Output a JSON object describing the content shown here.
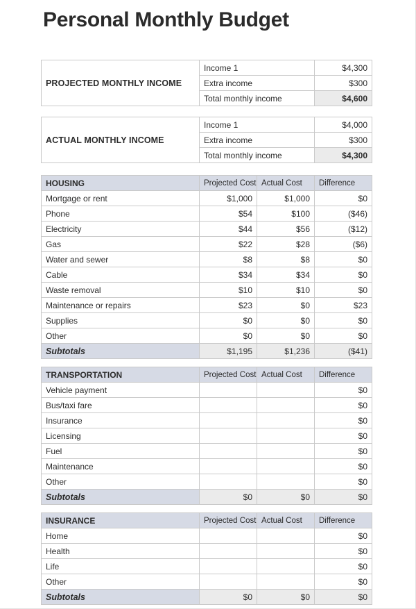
{
  "document": {
    "title": "Personal Monthly Budget"
  },
  "income_tables": [
    {
      "title": "PROJECTED MONTHLY INCOME",
      "rows": [
        {
          "label": "Income 1",
          "value": "$4,300",
          "total": false
        },
        {
          "label": "Extra income",
          "value": "$300",
          "total": false
        },
        {
          "label": "Total monthly income",
          "value": "$4,600",
          "total": true
        }
      ]
    },
    {
      "title": "ACTUAL MONTHLY INCOME",
      "rows": [
        {
          "label": "Income 1",
          "value": "$4,000",
          "total": false
        },
        {
          "label": "Extra income",
          "value": "$300",
          "total": false
        },
        {
          "label": "Total monthly income",
          "value": "$4,300",
          "total": true
        }
      ]
    }
  ],
  "columns": {
    "projected": "Projected Cost",
    "actual": "Actual Cost",
    "difference": "Difference"
  },
  "subtotal_label": "Subtotals",
  "sections": [
    {
      "name": "HOUSING",
      "rows": [
        {
          "label": "Mortgage or rent",
          "projected": "$1,000",
          "actual": "$1,000",
          "difference": "$0",
          "negative": false
        },
        {
          "label": "Phone",
          "projected": "$54",
          "actual": "$100",
          "difference": "($46)",
          "negative": true
        },
        {
          "label": "Electricity",
          "projected": "$44",
          "actual": "$56",
          "difference": "($12)",
          "negative": true
        },
        {
          "label": "Gas",
          "projected": "$22",
          "actual": "$28",
          "difference": "($6)",
          "negative": true
        },
        {
          "label": "Water and sewer",
          "projected": "$8",
          "actual": "$8",
          "difference": "$0",
          "negative": false
        },
        {
          "label": "Cable",
          "projected": "$34",
          "actual": "$34",
          "difference": "$0",
          "negative": false
        },
        {
          "label": "Waste removal",
          "projected": "$10",
          "actual": "$10",
          "difference": "$0",
          "negative": false
        },
        {
          "label": "Maintenance or repairs",
          "projected": "$23",
          "actual": "$0",
          "difference": "$23",
          "negative": false
        },
        {
          "label": "Supplies",
          "projected": "$0",
          "actual": "$0",
          "difference": "$0",
          "negative": false
        },
        {
          "label": "Other",
          "projected": "$0",
          "actual": "$0",
          "difference": "$0",
          "negative": false
        }
      ],
      "subtotals": {
        "projected": "$1,195",
        "actual": "$1,236",
        "difference": "($41)",
        "negative": true
      }
    },
    {
      "name": "TRANSPORTATION",
      "rows": [
        {
          "label": "Vehicle payment",
          "projected": "",
          "actual": "",
          "difference": "$0",
          "negative": false
        },
        {
          "label": "Bus/taxi fare",
          "projected": "",
          "actual": "",
          "difference": "$0",
          "negative": false
        },
        {
          "label": "Insurance",
          "projected": "",
          "actual": "",
          "difference": "$0",
          "negative": false
        },
        {
          "label": "Licensing",
          "projected": "",
          "actual": "",
          "difference": "$0",
          "negative": false
        },
        {
          "label": "Fuel",
          "projected": "",
          "actual": "",
          "difference": "$0",
          "negative": false
        },
        {
          "label": "Maintenance",
          "projected": "",
          "actual": "",
          "difference": "$0",
          "negative": false
        },
        {
          "label": "Other",
          "projected": "",
          "actual": "",
          "difference": "$0",
          "negative": false
        }
      ],
      "subtotals": {
        "projected": "$0",
        "actual": "$0",
        "difference": "$0",
        "negative": false
      }
    },
    {
      "name": "INSURANCE",
      "rows": [
        {
          "label": "Home",
          "projected": "",
          "actual": "",
          "difference": "$0",
          "negative": false
        },
        {
          "label": "Health",
          "projected": "",
          "actual": "",
          "difference": "$0",
          "negative": false
        },
        {
          "label": "Life",
          "projected": "",
          "actual": "",
          "difference": "$0",
          "negative": false
        },
        {
          "label": "Other",
          "projected": "",
          "actual": "",
          "difference": "$0",
          "negative": false
        }
      ],
      "subtotals": {
        "projected": "$0",
        "actual": "$0",
        "difference": "$0",
        "negative": false
      }
    }
  ],
  "layout": {
    "income_table_tops": [
      86,
      168
    ],
    "section_tops": [
      252,
      528,
      738
    ],
    "colors": {
      "header_fill": "#d6dae5",
      "shaded_fill": "#ebebeb",
      "negative_text": "#ee1111",
      "grid_line": "#c9c9c9"
    }
  }
}
